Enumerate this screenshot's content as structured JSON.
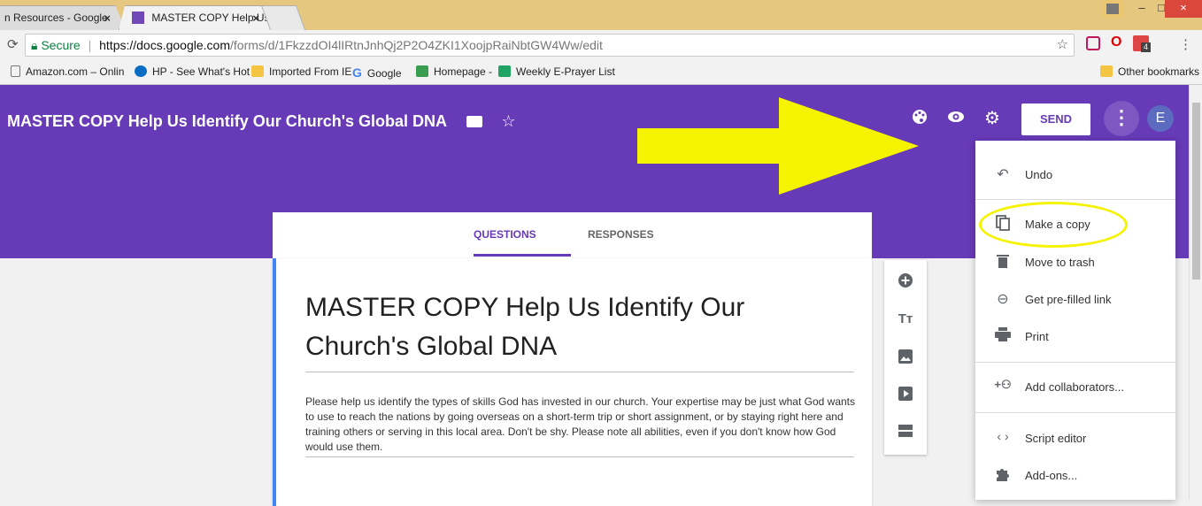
{
  "browser": {
    "tabs": [
      {
        "label": "n Resources - Google",
        "active": false
      },
      {
        "label": "MASTER COPY Help Us Id",
        "active": true
      }
    ],
    "tab_close": "×",
    "address": {
      "secure_label": "Secure",
      "url_host": "https://docs.google.com",
      "url_path": "/forms/d/1FkzzdOI4lIRtnJnhQj2P2O4ZKI1XoojpRaiNbtGW4Ww/edit"
    },
    "window_controls": {
      "minimize": "–",
      "restore": "□",
      "close": "×"
    },
    "extension_badge": "4",
    "bookmarks": [
      {
        "label": "Amazon.com – Onlin",
        "icon": "page-icon"
      },
      {
        "label": "HP - See What's Hot",
        "icon": "hp-icon"
      },
      {
        "label": "Imported From IE",
        "icon": "folder-icon"
      },
      {
        "label": "Google",
        "icon": "google-icon"
      },
      {
        "label": "Homepage -",
        "icon": "homepage-icon"
      },
      {
        "label": "Weekly E-Prayer List",
        "icon": "sheets-icon"
      }
    ],
    "other_bookmarks": "Other bookmarks"
  },
  "form_header": {
    "title": "MASTER COPY Help Us Identify Our Church's Global DNA",
    "send_label": "SEND",
    "more_label": "⋮",
    "avatar_initial": "E",
    "color": "#673ab7"
  },
  "form_tabs": {
    "questions": "QUESTIONS",
    "responses": "RESPONSES"
  },
  "form_card": {
    "title": "MASTER COPY Help Us Identify Our Church's Global DNA",
    "description": "Please help us identify the types of skills God has invested in our church. Your expertise may be just what God wants to use to reach the nations by going overseas on a short-term trip or short assignment, or by staying right here and training others or serving in this local area. Don't be shy. Please note all abilities, even if you don't know how God would use them."
  },
  "side_toolbar": {
    "tools": [
      "add-question-icon",
      "title-text-icon",
      "image-icon",
      "video-icon",
      "section-icon"
    ]
  },
  "menu": {
    "items": [
      {
        "label": "Undo",
        "icon": "undo-icon"
      },
      {
        "label": "Make a copy",
        "icon": "copy-icon"
      },
      {
        "label": "Move to trash",
        "icon": "trash-icon"
      },
      {
        "label": "Get pre-filled link",
        "icon": "link-icon"
      },
      {
        "label": "Print",
        "icon": "print-icon"
      },
      {
        "label": "Add collaborators...",
        "icon": "add-people-icon"
      },
      {
        "label": "Script editor",
        "icon": "code-icon"
      },
      {
        "label": "Add-ons...",
        "icon": "puzzle-icon"
      }
    ]
  },
  "annotation_colors": {
    "arrow": "#f5f300",
    "ellipse": "#f5f300"
  }
}
